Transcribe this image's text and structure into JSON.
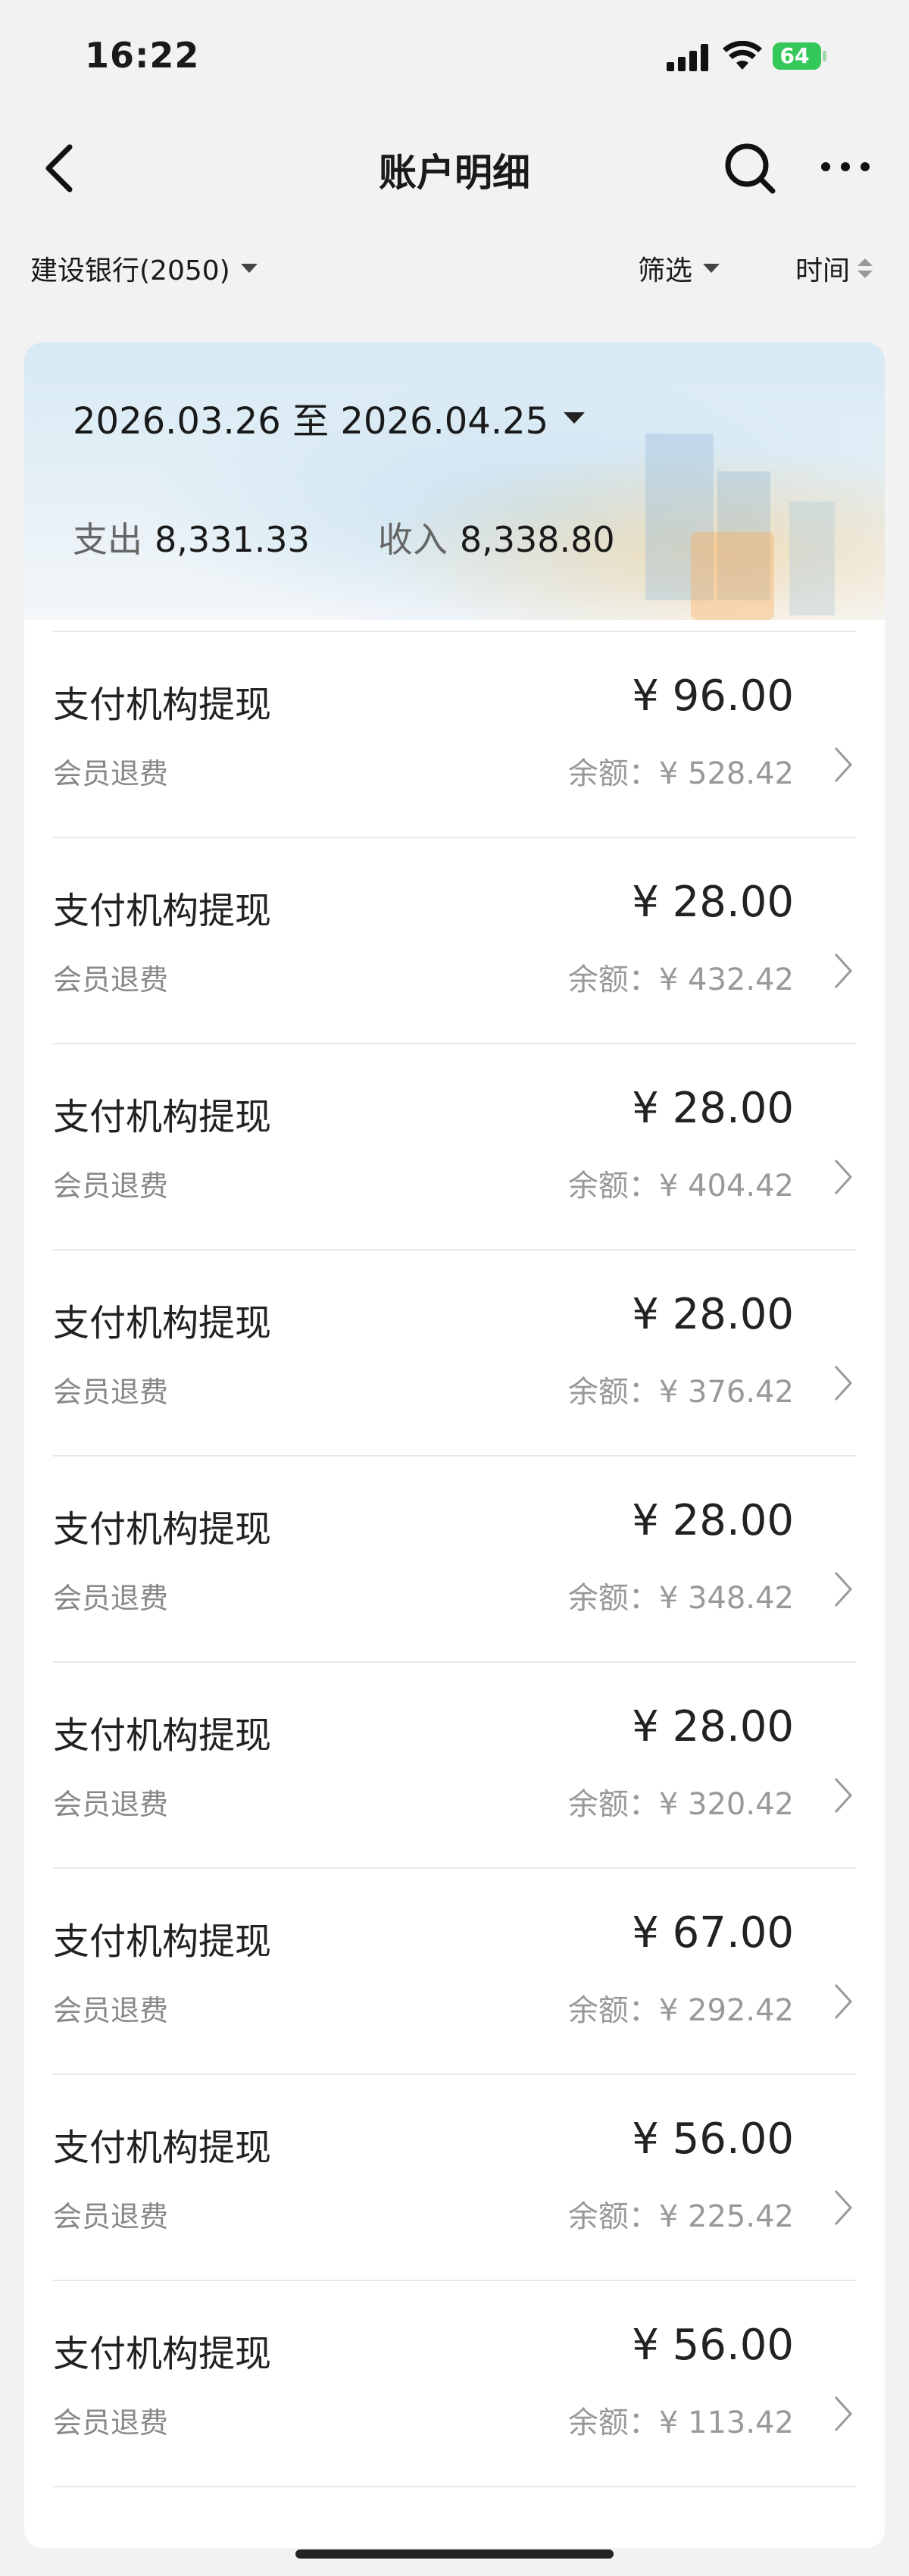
{
  "status": {
    "time": "16:22",
    "battery": "64"
  },
  "nav": {
    "title": "账户明细",
    "icons": [
      "back-icon",
      "search-icon",
      "more-icon"
    ]
  },
  "filters": {
    "bank": "建设银行(2050)",
    "filter": "筛选",
    "time": "时间"
  },
  "summary": {
    "range": "2026.03.26 至 2026.04.25",
    "expense_label": "支出",
    "expense": "8,331.33",
    "income_label": "收入",
    "income": "8,338.80"
  },
  "transactions": [
    {
      "name": "支付机构提现",
      "amount": "¥ 96.00",
      "note": "会员退费",
      "balance": "余额：¥ 528.42"
    },
    {
      "name": "支付机构提现",
      "amount": "¥ 28.00",
      "note": "会员退费",
      "balance": "余额：¥ 432.42"
    },
    {
      "name": "支付机构提现",
      "amount": "¥ 28.00",
      "note": "会员退费",
      "balance": "余额：¥ 404.42"
    },
    {
      "name": "支付机构提现",
      "amount": "¥ 28.00",
      "note": "会员退费",
      "balance": "余额：¥ 376.42"
    },
    {
      "name": "支付机构提现",
      "amount": "¥ 28.00",
      "note": "会员退费",
      "balance": "余额：¥ 348.42"
    },
    {
      "name": "支付机构提现",
      "amount": "¥ 28.00",
      "note": "会员退费",
      "balance": "余额：¥ 320.42"
    },
    {
      "name": "支付机构提现",
      "amount": "¥ 67.00",
      "note": "会员退费",
      "balance": "余额：¥ 292.42"
    },
    {
      "name": "支付机构提现",
      "amount": "¥ 56.00",
      "note": "会员退费",
      "balance": "余额：¥ 225.42"
    },
    {
      "name": "支付机构提现",
      "amount": "¥ 56.00",
      "note": "会员退费",
      "balance": "余额：¥ 113.42"
    }
  ]
}
